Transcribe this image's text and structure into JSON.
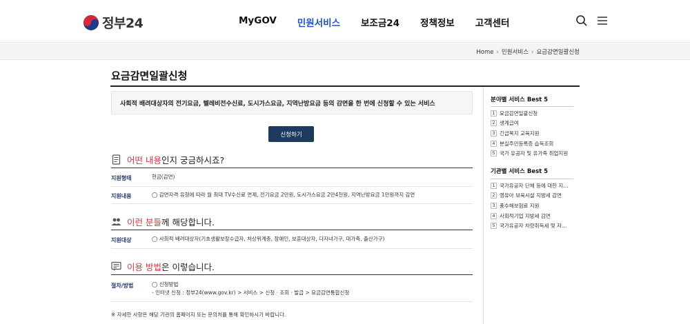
{
  "header": {
    "logo_text": "정부24",
    "nav": [
      {
        "label": "MyGOV",
        "active": false
      },
      {
        "label": "민원서비스",
        "active": true
      },
      {
        "label": "보조금24",
        "active": false
      },
      {
        "label": "정책정보",
        "active": false
      },
      {
        "label": "고객센터",
        "active": false
      }
    ]
  },
  "breadcrumb": [
    "Home",
    "민원서비스",
    "요금감면일괄신청"
  ],
  "page": {
    "title": "요금감면일괄신청",
    "summary": "사회적 배려대상자의 전기요금, 텔레비전수신료, 도시가스요금, 지역난방요금 등의 감면을 한 번에 신청할 수 있는 서비스",
    "apply_button": "신청하기"
  },
  "sections": {
    "what": {
      "highlight": "어떤 내용",
      "rest": "인지 궁금하시죠?",
      "rows": [
        {
          "label": "지원형태",
          "value": "현금(감면)"
        },
        {
          "label": "지원내용",
          "value": "◯ 감면자격 유형에 따라 월 최대 TV수신료 면제, 전기요금 2만원, 도시가스요금 2만4천원, 지역난방요금 1만원까지 감면"
        }
      ]
    },
    "who": {
      "highlight": "이런 분들",
      "rest": "께 해당합니다.",
      "rows": [
        {
          "label": "지원대상",
          "value": "◯ 사회적 배려대상자(기초생활보장수급자, 차상위계층, 장애인, 보훈대상자, 다자녀가구, 대가족, 출산가구)"
        }
      ]
    },
    "how": {
      "highlight": "이용 방법",
      "rest": "은 이렇습니다.",
      "rows": [
        {
          "label": "절차/방법",
          "value1": "◯ 신청방법",
          "value2": "- 인터넷 신청 : 정부24(www.gov.kr) > 서비스 > 신청 · 조회 · 발급 > 요금감면통합신청"
        }
      ]
    }
  },
  "footnote": "※ 자세한 사항은 해당 기관의 홈페이지 또는 문의처를 통해 확인하시기 바랍니다.",
  "sidebar": {
    "field_title": "분야별 서비스 Best 5",
    "field_items": [
      "요금감면일괄신청",
      "생계급여",
      "긴급복지 교육지원",
      "분실주민등록증 습득조회",
      "국가 유공자 및 유가족 취업지원"
    ],
    "org_title": "기관별 서비스 Best 5",
    "org_items": [
      "국가유공자 단체 등에 대한 지…",
      "영유아 보육시설 지방세 감면",
      "풍수해보험료 지원",
      "사회적기업 지방세 감면",
      "국가유공자 차량취득세 및 자…"
    ]
  },
  "colors": {
    "accent": "#1d4ed8",
    "highlight": "#d63447",
    "button": "#1f3a5f"
  }
}
